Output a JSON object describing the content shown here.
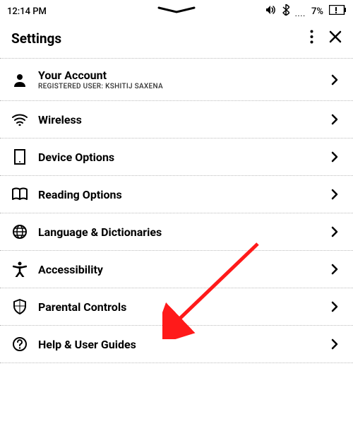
{
  "status": {
    "time": "12:14 PM",
    "battery_percent": "7%"
  },
  "header": {
    "title": "Settings"
  },
  "items": [
    {
      "title": "Your Account",
      "subtitle": "REGISTERED USER: KSHITIJ SAXENA"
    },
    {
      "title": "Wireless"
    },
    {
      "title": "Device Options"
    },
    {
      "title": "Reading Options"
    },
    {
      "title": "Language & Dictionaries"
    },
    {
      "title": "Accessibility"
    },
    {
      "title": "Parental Controls"
    },
    {
      "title": "Help & User Guides"
    }
  ]
}
